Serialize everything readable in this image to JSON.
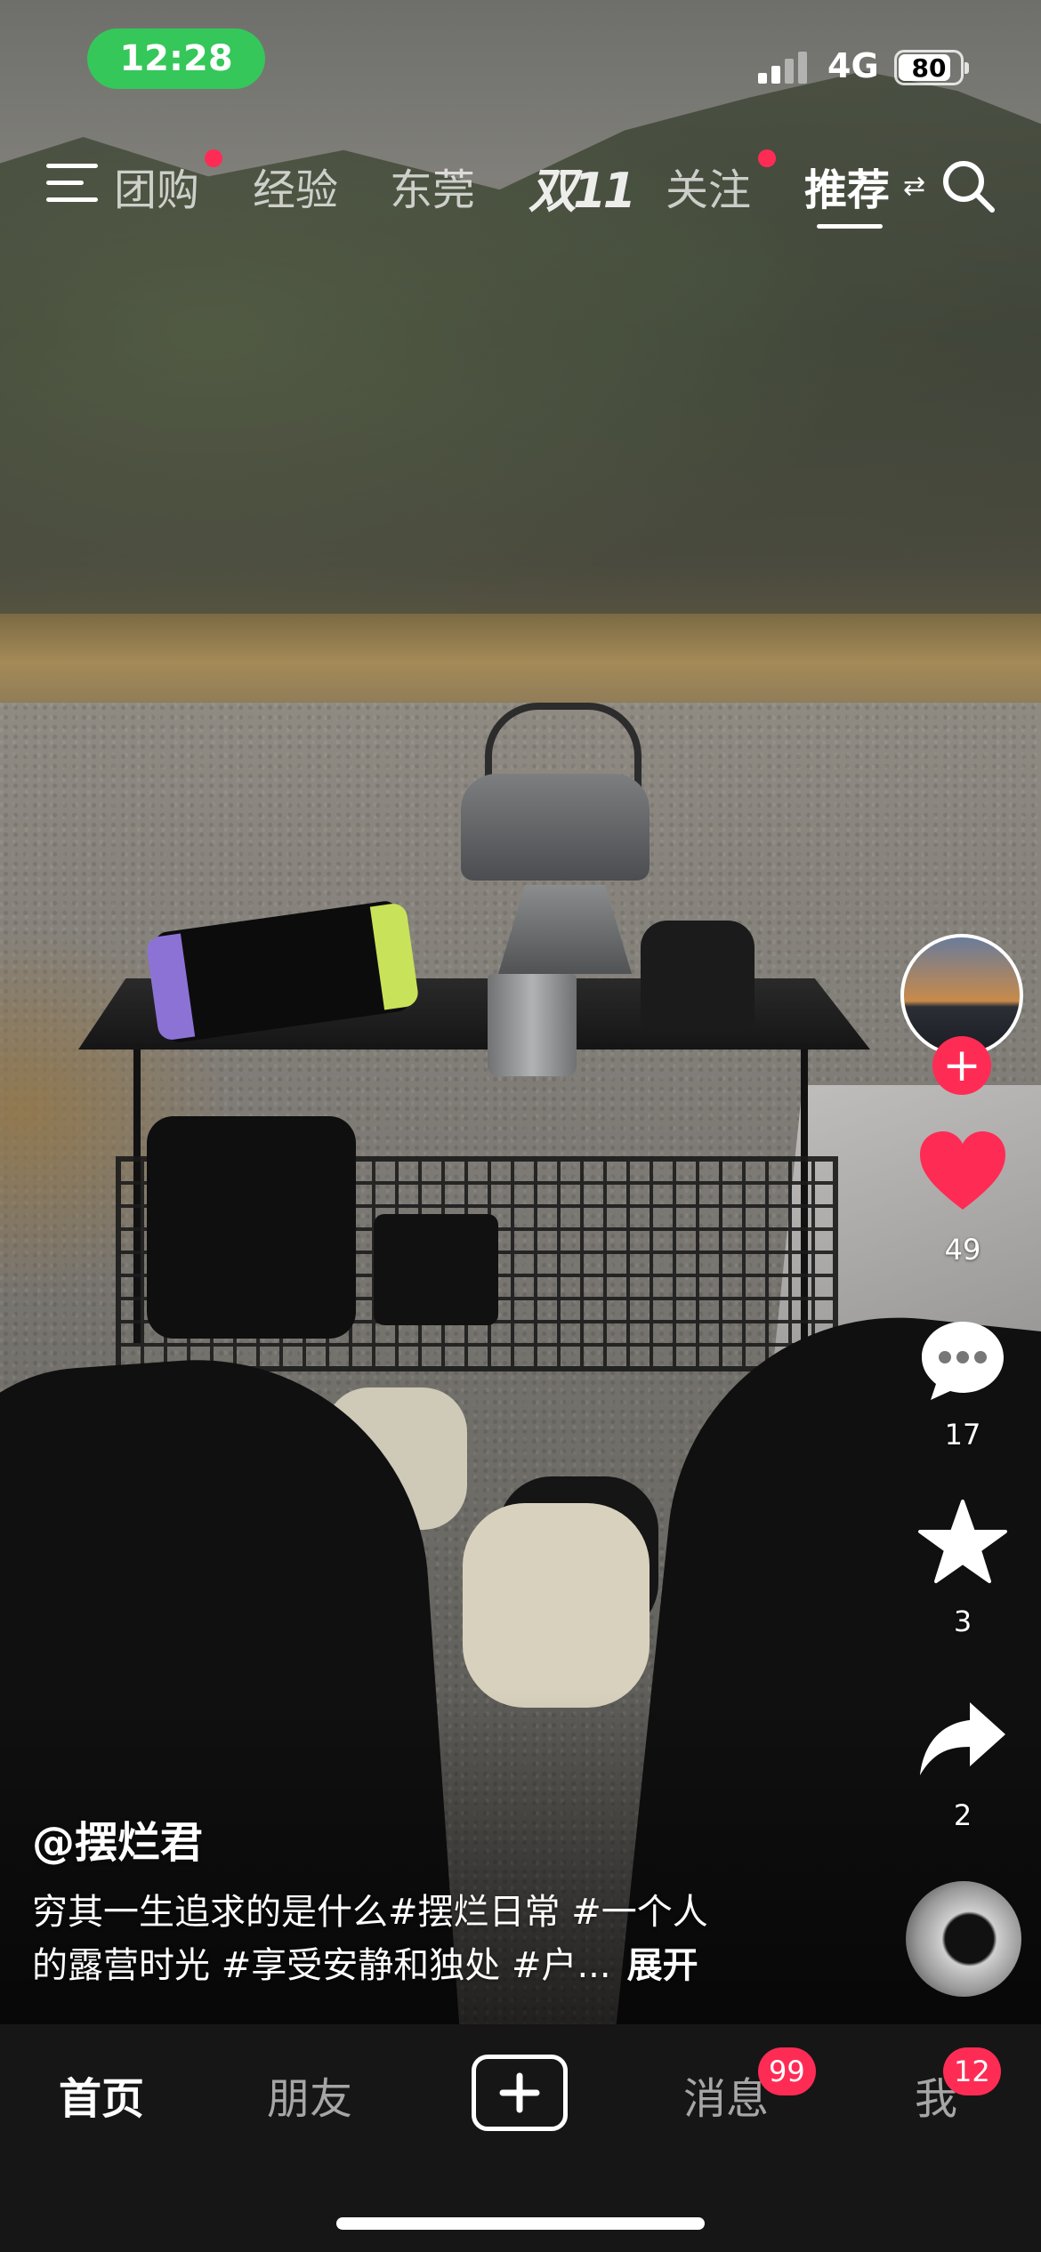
{
  "status_bar": {
    "time": "12:28",
    "network": "4G",
    "battery_level": "80"
  },
  "top_nav": {
    "tabs": [
      {
        "label": "团购",
        "has_dot": true
      },
      {
        "label": "经验",
        "has_dot": false
      },
      {
        "label": "东莞",
        "has_dot": false
      },
      {
        "label": "双11",
        "has_dot": false
      },
      {
        "label": "关注",
        "has_dot": true
      },
      {
        "label": "推荐",
        "has_dot": false,
        "active": true
      }
    ],
    "icons": [
      "menu-icon",
      "search-icon"
    ]
  },
  "right_rail": {
    "likes": "49",
    "comments": "17",
    "favorites": "3",
    "shares": "2"
  },
  "post": {
    "author": "@摆烂君",
    "caption_line1": "穷其一生追求的是什么#摆烂日常 #一个人",
    "caption_line2": "的露营时光 #享受安静和独处 #户...",
    "expand_label": "展开"
  },
  "bottom_nav": {
    "home": "首页",
    "friends": "朋友",
    "messages": "消息",
    "messages_badge": "99",
    "me": "我",
    "me_badge": "12"
  },
  "colors": {
    "accent": "#fe2c55",
    "status_green": "#35c759",
    "tabbar_bg": "#161616"
  }
}
